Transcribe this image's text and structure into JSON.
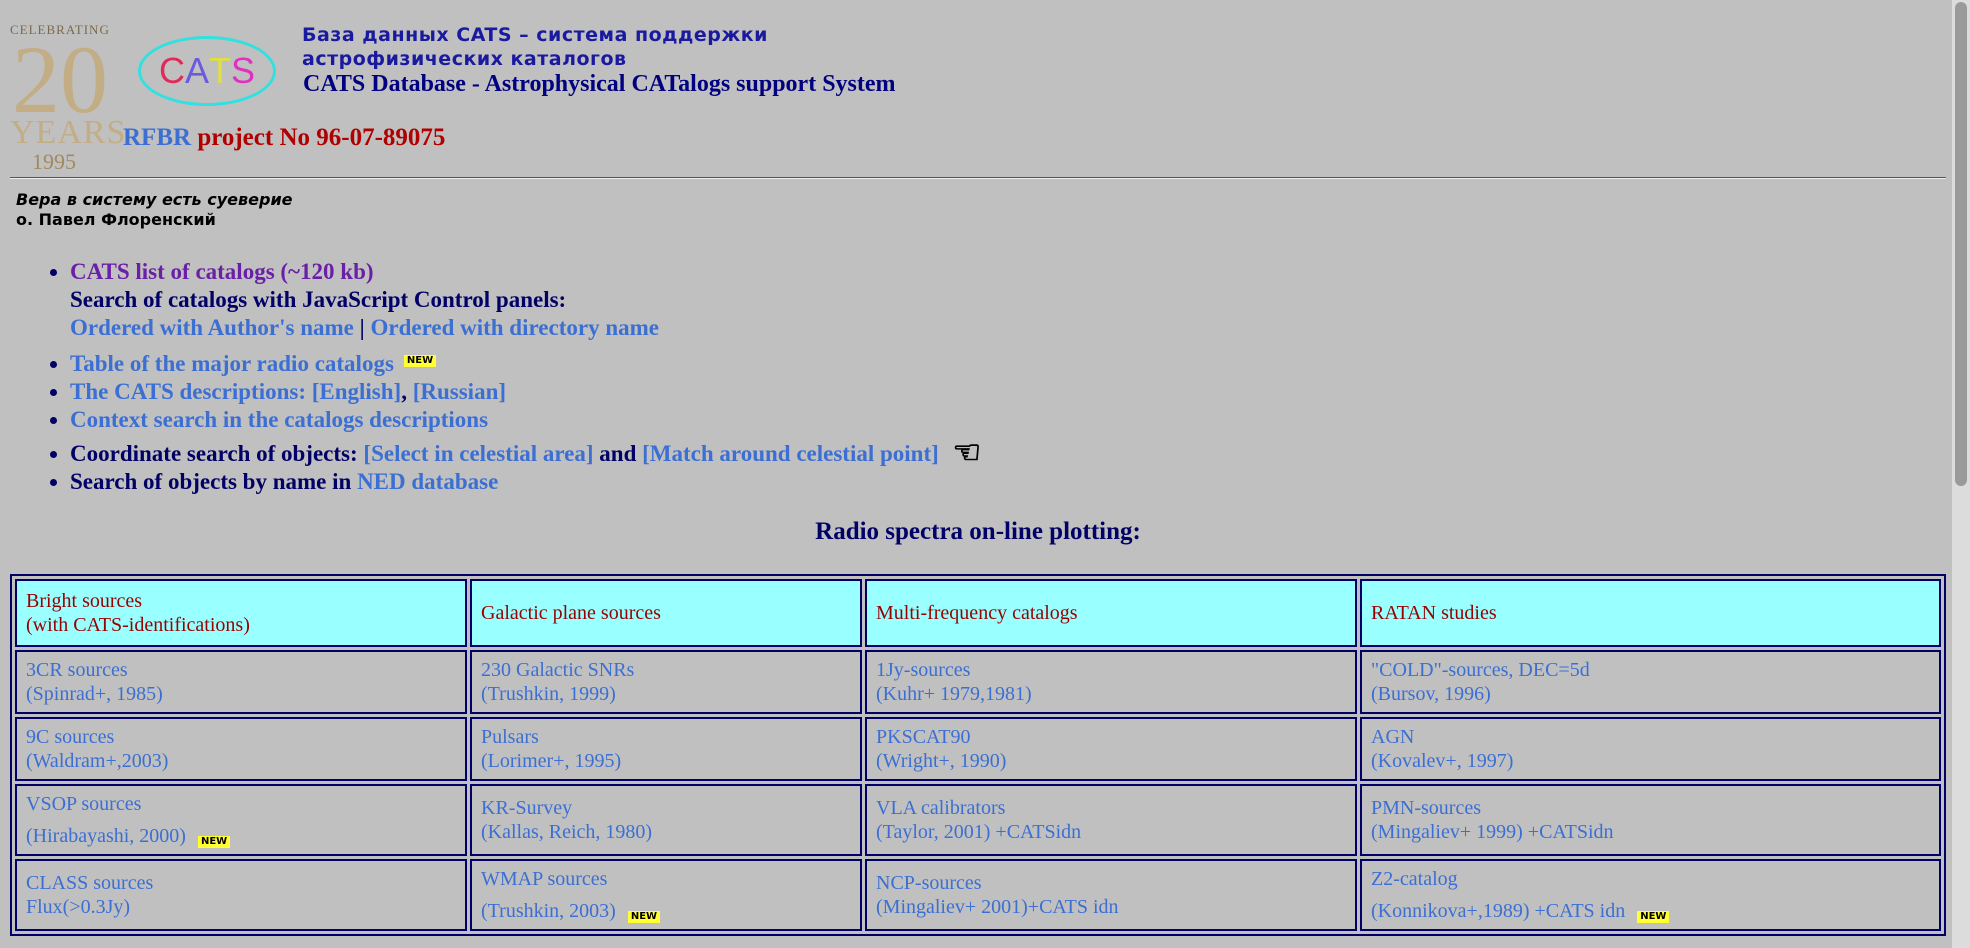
{
  "logo_20": {
    "celebrating": "CELEBRATING",
    "number": "20",
    "years": "YEARS",
    "year": "1995"
  },
  "cats_logo": {
    "letters": [
      "C",
      "A",
      "T",
      "S"
    ],
    "colors": [
      "#e02a5a",
      "#6a5ae0",
      "#e0e040",
      "#e030c0"
    ]
  },
  "header": {
    "title_ru_line1": "База данных CATS – система поддержки",
    "title_ru_line2": "астрофизических каталогов",
    "title_en": "CATS Database - Astrophysical CATalogs support System",
    "rfbr": "RFBR",
    "project": "project No 96-07-89075"
  },
  "quote": {
    "line1": "Вера в систему есть суеверие",
    "line2": "о. Павел Флоренский"
  },
  "menu": {
    "list_link": "CATS list of catalogs (~120 kb)",
    "search_text": "Search of catalogs with JavaScript Control panels:",
    "ordered_author": "Ordered with Author's name",
    "sep": "|",
    "ordered_dir": "Ordered with directory name",
    "major_radio": "Table of the major radio catalogs",
    "descriptions": "The CATS descriptions: [English]",
    "comma": ",",
    "russian": "[Russian]",
    "context_search": "Context search in the catalogs descriptions",
    "coord_text": "Coordinate search of objects:",
    "select_area": "[Select in celestial area]",
    "and": "and",
    "match_point": "[Match around celestial point]",
    "byname_text": "Search of objects by name in",
    "ned": "NED database"
  },
  "new_badge": "NEW",
  "radio_spectra_title": "Radio spectra on-line plotting:",
  "table": {
    "headers": [
      {
        "l1": "Bright sources",
        "l2": "(with CATS-identifications)"
      },
      {
        "l1": "Galactic plane sources",
        "l2": ""
      },
      {
        "l1": "Multi-frequency catalogs",
        "l2": ""
      },
      {
        "l1": "RATAN studies",
        "l2": ""
      }
    ],
    "rows": [
      [
        {
          "l1": "3CR sources",
          "l2": "(Spinrad+, 1985)"
        },
        {
          "l1": "230 Galactic SNRs",
          "l2": "(Trushkin, 1999)"
        },
        {
          "l1": "1Jy-sources",
          "l2": "(Kuhr+ 1979,1981)"
        },
        {
          "l1": "\"COLD\"-sources, DEC=5d",
          "l2": "(Bursov, 1996)"
        }
      ],
      [
        {
          "l1": "9C sources",
          "l2": "(Waldram+,2003)"
        },
        {
          "l1": "Pulsars",
          "l2": "(Lorimer+, 1995)"
        },
        {
          "l1": "PKSCAT90",
          "l2": "(Wright+, 1990)"
        },
        {
          "l1": "AGN",
          "l2": "(Kovalev+, 1997)"
        }
      ],
      [
        {
          "l1": "VSOP sources",
          "l2": "(Hirabayashi, 2000)"
        },
        {
          "l1": "KR-Survey",
          "l2": "(Kallas, Reich, 1980)"
        },
        {
          "l1": "VLA calibrators",
          "l2": "(Taylor, 2001) +CATSidn"
        },
        {
          "l1": "PMN-sources",
          "l2": "(Mingaliev+ 1999) +CATSidn"
        }
      ],
      [
        {
          "l1": "CLASS sources",
          "l2": "Flux(>0.3Jy)"
        },
        {
          "l1": "WMAP sources",
          "l2": "(Trushkin, 2003)"
        },
        {
          "l1": "NCP-sources",
          "l2": "(Mingaliev+ 2001)+CATS idn"
        },
        {
          "l1": "Z2-catalog",
          "l2": "(Konnikova+,1989) +CATS idn"
        }
      ]
    ]
  }
}
